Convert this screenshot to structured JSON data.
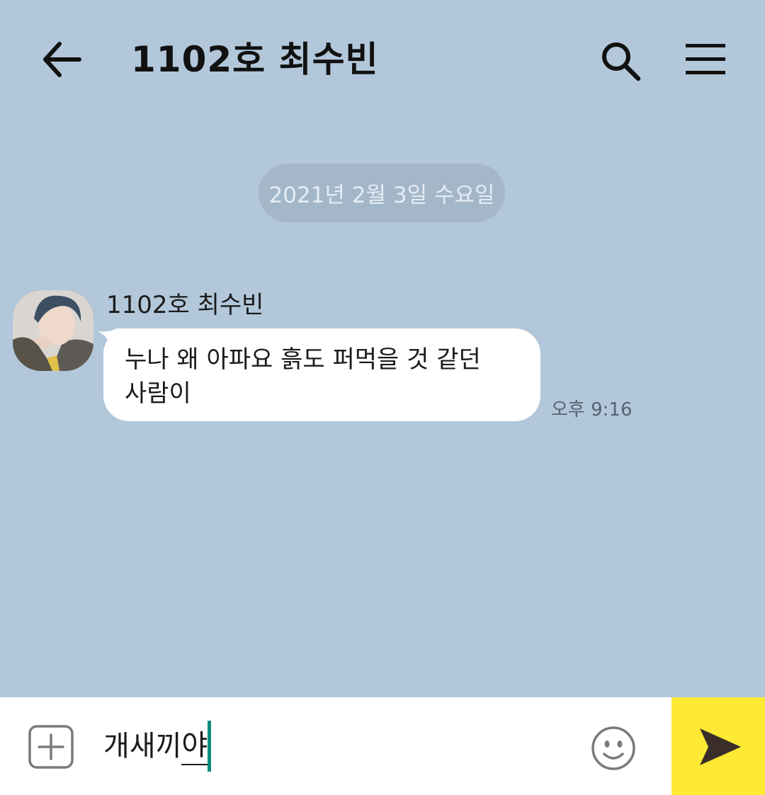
{
  "header": {
    "title": "1102호 최수빈",
    "back_icon": "arrow-left-icon",
    "search_icon": "search-icon",
    "menu_icon": "hamburger-menu-icon"
  },
  "date_divider": "2021년 2월 3일 수요일",
  "messages": [
    {
      "sender": "1102호 최수빈",
      "text": "누나 왜 아파요 흙도 퍼먹을 것 같던 사람이",
      "time": "오후 9:16"
    }
  ],
  "input": {
    "value": "개새끼",
    "composing": "야",
    "plus_icon": "plus-square-icon",
    "emoji_icon": "smiley-icon",
    "send_icon": "send-icon"
  },
  "colors": {
    "background": "#b2c7da",
    "bubble": "#ffffff",
    "send_button": "#fee934",
    "caret": "#0d8a7a"
  }
}
